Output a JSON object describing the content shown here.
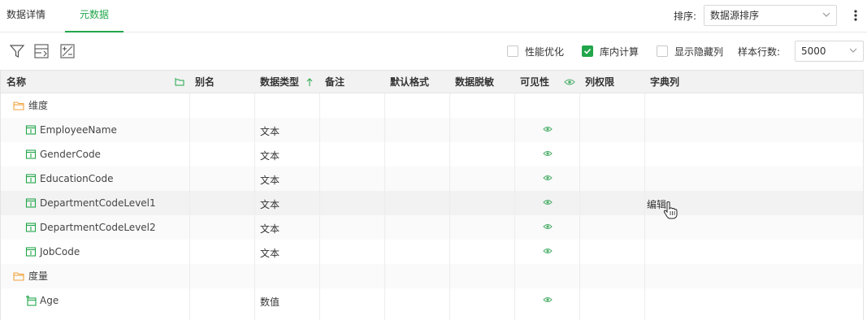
{
  "tabs": [
    {
      "label": "数据详情",
      "active": false
    },
    {
      "label": "元数据",
      "active": true
    }
  ],
  "sort": {
    "label": "排序:",
    "value": "数据源排序"
  },
  "toolbar": {
    "icons": [
      "filter-icon",
      "sort-fields-icon",
      "calculated-field-icon"
    ],
    "options": [
      {
        "label": "性能优化",
        "checked": false
      },
      {
        "label": "库内计算",
        "checked": true
      },
      {
        "label": "显示隐藏列",
        "checked": false
      }
    ],
    "sample_rows_label": "样本行数:",
    "sample_rows_value": "5000"
  },
  "columns": [
    "名称",
    "别名",
    "数据类型",
    "备注",
    "默认格式",
    "数据脱敏",
    "可见性",
    "列权限",
    "字典列"
  ],
  "rows": [
    {
      "kind": "folder",
      "name": "维度",
      "type": "",
      "visible": false,
      "dict": ""
    },
    {
      "kind": "dimension",
      "name": "EmployeeName",
      "type": "文本",
      "visible": true,
      "dict": ""
    },
    {
      "kind": "dimension",
      "name": "GenderCode",
      "type": "文本",
      "visible": true,
      "dict": ""
    },
    {
      "kind": "dimension",
      "name": "EducationCode",
      "type": "文本",
      "visible": true,
      "dict": ""
    },
    {
      "kind": "dimension",
      "name": "DepartmentCodeLevel1",
      "type": "文本",
      "visible": true,
      "dict": "编辑"
    },
    {
      "kind": "dimension",
      "name": "DepartmentCodeLevel2",
      "type": "文本",
      "visible": true,
      "dict": ""
    },
    {
      "kind": "dimension",
      "name": "JobCode",
      "type": "文本",
      "visible": true,
      "dict": ""
    },
    {
      "kind": "folder",
      "name": "度量",
      "type": "",
      "visible": false,
      "dict": ""
    },
    {
      "kind": "measure",
      "name": "Age",
      "type": "数值",
      "visible": true,
      "dict": ""
    }
  ],
  "colors": {
    "accent": "#22a64b",
    "folder": "#f0a23c",
    "eye": "#4caf6a"
  }
}
